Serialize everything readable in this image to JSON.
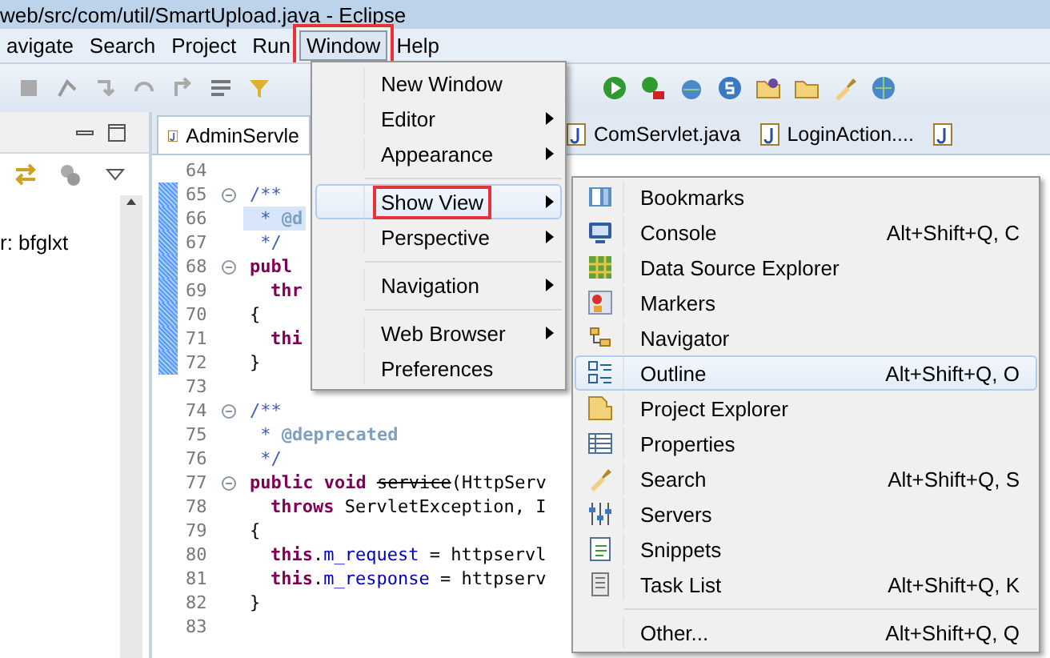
{
  "window": {
    "title": "web/src/com/util/SmartUpload.java - Eclipse"
  },
  "menubar": [
    {
      "label": "avigate",
      "selected": false,
      "highlighted": false
    },
    {
      "label": "Search",
      "selected": false,
      "highlighted": false
    },
    {
      "label": "Project",
      "selected": false,
      "highlighted": false
    },
    {
      "label": "Run",
      "selected": false,
      "highlighted": false
    },
    {
      "label": "Window",
      "selected": true,
      "highlighted": true
    },
    {
      "label": "Help",
      "selected": false,
      "highlighted": false
    }
  ],
  "left_panel": {
    "text": "r: bfglxt"
  },
  "editor": {
    "tabs": [
      {
        "label": "AdminServle",
        "selected": true
      },
      {
        "label": "ComServlet.java",
        "selected": false
      },
      {
        "label": "LoginAction....",
        "selected": false
      },
      {
        "selected": false
      }
    ],
    "lines": [
      {
        "number": "64",
        "foldable": false,
        "current": false,
        "in_range": false
      },
      {
        "number": "65",
        "foldable": true,
        "current": false,
        "in_range": true,
        "indented": false,
        "tokens": [
          {
            "text": "/**",
            "kind": "comment"
          }
        ]
      },
      {
        "number": "66",
        "foldable": false,
        "current": true,
        "in_range": true,
        "indented": false,
        "tokens": [
          {
            "text": " *",
            "kind": "comment"
          },
          {
            "text": " @d",
            "kind": "tag"
          }
        ]
      },
      {
        "number": "67",
        "foldable": false,
        "current": false,
        "in_range": true,
        "indented": false,
        "tokens": [
          {
            "text": " */",
            "kind": "comment"
          }
        ]
      },
      {
        "number": "68",
        "foldable": true,
        "current": false,
        "in_range": true,
        "indented": false,
        "tokens": [
          {
            "text": "publ",
            "kind": "keyword"
          }
        ]
      },
      {
        "number": "69",
        "foldable": false,
        "current": false,
        "in_range": true,
        "indented": true,
        "tokens": [
          {
            "text": "thr",
            "kind": "keyword"
          }
        ]
      },
      {
        "number": "70",
        "foldable": false,
        "current": false,
        "in_range": true,
        "indented": false,
        "tokens": [
          {
            "text": "{",
            "kind": "plain"
          }
        ]
      },
      {
        "number": "71",
        "foldable": false,
        "current": false,
        "in_range": true,
        "indented": true,
        "tokens": [
          {
            "text": "thi",
            "kind": "keyword"
          }
        ]
      },
      {
        "number": "72",
        "foldable": false,
        "current": false,
        "in_range": true,
        "indented": false,
        "tokens": [
          {
            "text": "}",
            "kind": "plain"
          }
        ]
      },
      {
        "number": "73",
        "foldable": false,
        "current": false,
        "in_range": false
      },
      {
        "number": "74",
        "foldable": true,
        "current": false,
        "in_range": false,
        "indented": false,
        "tokens": [
          {
            "text": "/**",
            "kind": "comment"
          }
        ]
      },
      {
        "number": "75",
        "foldable": false,
        "current": false,
        "in_range": false,
        "indented": false,
        "tokens": [
          {
            "text": " *",
            "kind": "comment"
          },
          {
            "text": " @deprecated",
            "kind": "tag"
          }
        ]
      },
      {
        "number": "76",
        "foldable": false,
        "current": false,
        "in_range": false,
        "indented": false,
        "tokens": [
          {
            "text": " */",
            "kind": "comment"
          }
        ]
      },
      {
        "number": "77",
        "foldable": true,
        "current": false,
        "in_range": false,
        "indented": false,
        "tokens": [
          {
            "text": "public void",
            "kind": "keyword"
          },
          {
            "text": "service",
            "kind": "deprecated"
          },
          {
            "text": "(HttpServ",
            "kind": "plain"
          }
        ]
      },
      {
        "number": "78",
        "foldable": false,
        "current": false,
        "in_range": false,
        "indented": true,
        "tokens": [
          {
            "text": "throws",
            "kind": "keyword"
          },
          {
            "text": " ServletException, I",
            "kind": "plain"
          }
        ]
      },
      {
        "number": "79",
        "foldable": false,
        "current": false,
        "in_range": false,
        "indented": false,
        "tokens": [
          {
            "text": "{",
            "kind": "plain"
          }
        ]
      },
      {
        "number": "80",
        "foldable": false,
        "current": false,
        "in_range": false,
        "indented": true,
        "tokens": [
          {
            "text": "this",
            "kind": "keyword"
          },
          {
            "text": ".",
            "kind": "plain"
          },
          {
            "text": "m_request",
            "kind": "field"
          },
          {
            "text": " = httpservl",
            "kind": "plain"
          }
        ]
      },
      {
        "number": "81",
        "foldable": false,
        "current": false,
        "in_range": false,
        "indented": true,
        "tokens": [
          {
            "text": "this",
            "kind": "keyword"
          },
          {
            "text": ".",
            "kind": "plain"
          },
          {
            "text": "m_response",
            "kind": "field"
          },
          {
            "text": " = httpserv",
            "kind": "plain"
          }
        ]
      },
      {
        "number": "82",
        "foldable": false,
        "current": false,
        "in_range": false,
        "indented": false,
        "tokens": [
          {
            "text": "}",
            "kind": "plain"
          }
        ]
      },
      {
        "number": "83",
        "foldable": false,
        "current": false,
        "in_range": false
      }
    ]
  },
  "window_menu": {
    "items": [
      {
        "kind": "item",
        "label": "New Window",
        "submenu": false,
        "selected": false,
        "highlighted": false
      },
      {
        "kind": "item",
        "label": "Editor",
        "submenu": true,
        "selected": false,
        "highlighted": false
      },
      {
        "kind": "item",
        "label": "Appearance",
        "submenu": true,
        "selected": false,
        "highlighted": false
      },
      {
        "kind": "separator"
      },
      {
        "kind": "item",
        "label": "Show View",
        "submenu": true,
        "selected": true,
        "highlighted": true
      },
      {
        "kind": "item",
        "label": "Perspective",
        "submenu": true,
        "selected": false,
        "highlighted": false
      },
      {
        "kind": "separator"
      },
      {
        "kind": "item",
        "label": "Navigation",
        "submenu": true,
        "selected": false,
        "highlighted": false
      },
      {
        "kind": "separator"
      },
      {
        "kind": "item",
        "label": "Web Browser",
        "submenu": true,
        "selected": false,
        "highlighted": false
      },
      {
        "kind": "item",
        "label": "Preferences",
        "submenu": false,
        "selected": false,
        "highlighted": false
      }
    ]
  },
  "show_view_menu": {
    "items": [
      {
        "kind": "item",
        "label": "Bookmarks",
        "selected": false
      },
      {
        "kind": "item",
        "label": "Console",
        "shortcut": "Alt+Shift+Q, C",
        "selected": false
      },
      {
        "kind": "item",
        "label": "Data Source Explorer",
        "selected": false
      },
      {
        "kind": "item",
        "label": "Markers",
        "selected": false
      },
      {
        "kind": "item",
        "label": "Navigator",
        "selected": false
      },
      {
        "kind": "item",
        "label": "Outline",
        "shortcut": "Alt+Shift+Q, O",
        "selected": true
      },
      {
        "kind": "item",
        "label": "Project Explorer",
        "selected": false
      },
      {
        "kind": "item",
        "label": "Properties",
        "selected": false
      },
      {
        "kind": "item",
        "label": "Search",
        "shortcut": "Alt+Shift+Q, S",
        "selected": false
      },
      {
        "kind": "item",
        "label": "Servers",
        "selected": false
      },
      {
        "kind": "item",
        "label": "Snippets",
        "selected": false
      },
      {
        "kind": "item",
        "label": "Task List",
        "shortcut": "Alt+Shift+Q, K",
        "selected": false
      },
      {
        "kind": "separator"
      },
      {
        "kind": "item",
        "label": "Other...",
        "shortcut": "Alt+Shift+Q, Q",
        "selected": false
      }
    ]
  }
}
